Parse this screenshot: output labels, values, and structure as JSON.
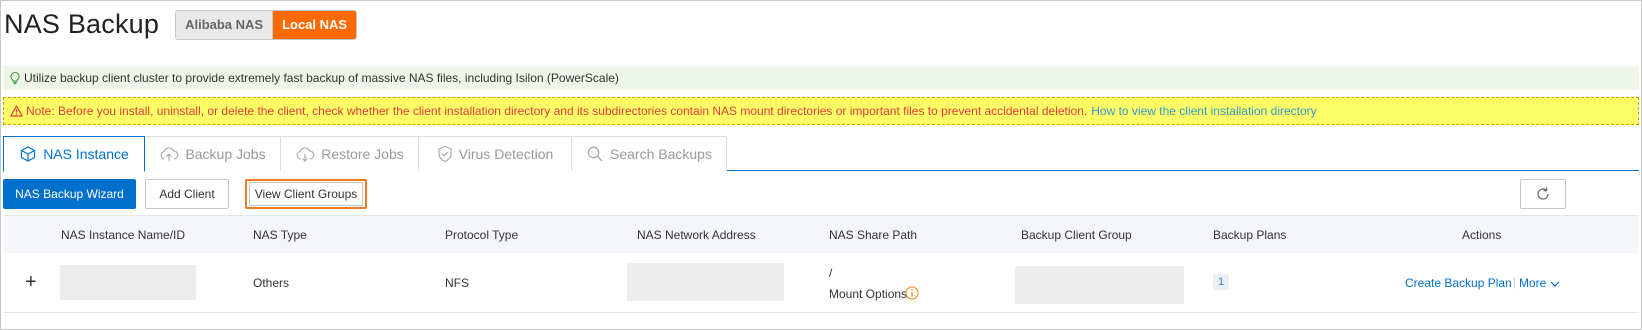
{
  "header": {
    "title": "NAS Backup",
    "switch": {
      "option_inactive": "Alibaba NAS",
      "option_active": "Local NAS"
    }
  },
  "notices": {
    "tip": "Utilize backup client cluster to provide extremely fast backup of massive NAS files, including Isilon (PowerScale)",
    "warning": "Note: Before you install, uninstall, or delete the client, check whether the client installation directory and its subdirectories contain NAS mount directories or important files to prevent accidental deletion.",
    "warning_link": "How to view the client installation directory"
  },
  "tabs": [
    {
      "label": "NAS Instance",
      "icon": "cube-icon",
      "active": true
    },
    {
      "label": "Backup Jobs",
      "icon": "cloud-upload-icon",
      "active": false
    },
    {
      "label": "Restore Jobs",
      "icon": "cloud-download-icon",
      "active": false
    },
    {
      "label": "Virus Detection",
      "icon": "shield-check-icon",
      "active": false
    },
    {
      "label": "Search Backups",
      "icon": "search-icon",
      "active": false
    }
  ],
  "toolbar": {
    "wizard": "NAS Backup Wizard",
    "add_client": "Add Client",
    "view_groups": "View Client Groups",
    "refresh_icon": "refresh-icon"
  },
  "table": {
    "columns": [
      "NAS Instance Name/ID",
      "NAS Type",
      "Protocol Type",
      "NAS Network Address",
      "NAS Share Path",
      "Backup Client Group",
      "Backup Plans",
      "Actions"
    ],
    "rows": [
      {
        "expand": "+",
        "nas_type": "Others",
        "protocol": "NFS",
        "share_path": "/",
        "mount_options": "Mount Options",
        "backup_plans": "1",
        "action_create": "Create Backup Plan",
        "action_more": "More"
      }
    ]
  },
  "colors": {
    "accent": "#0070cc",
    "brand_orange": "#ff6a00",
    "warning_bg": "#ffff66",
    "warning_text": "#e4393c",
    "tip_bg": "#eef6ea"
  }
}
